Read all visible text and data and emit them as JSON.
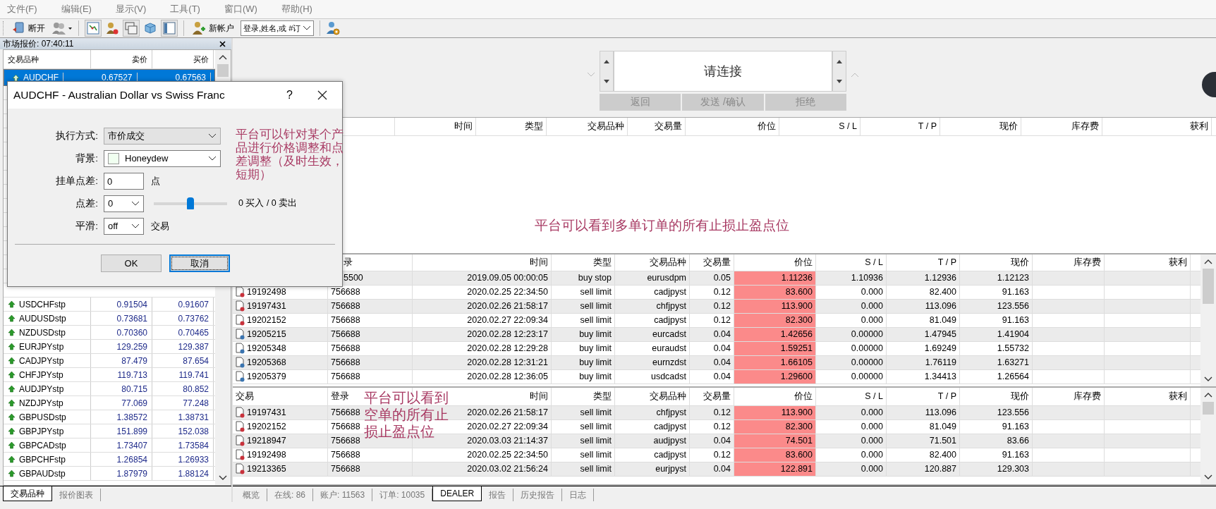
{
  "menu": [
    {
      "label": "文件(F)"
    },
    {
      "label": "编辑(E)"
    },
    {
      "label": "显示(V)"
    },
    {
      "label": "工具(T)"
    },
    {
      "label": "窗口(W)"
    },
    {
      "label": "帮助(H)"
    }
  ],
  "toolbar": {
    "disconnect": "断开",
    "new_account": "新帐户",
    "search": {
      "value": "登录,姓名,或 #订"
    }
  },
  "market_watch": {
    "title": "市场报价: 07:40:11",
    "columns": [
      "交易品种",
      "卖价",
      "买价"
    ],
    "top_rows": [
      {
        "symbol": "AUDCHF",
        "bid": "0.67527",
        "ask": "0.67563",
        "selected": true
      }
    ],
    "lower_rows": [
      {
        "symbol": "USDCHFstp",
        "bid": "0.91504",
        "ask": "0.91607",
        "selected": false
      },
      {
        "symbol": "AUDUSDstp",
        "bid": "0.73681",
        "ask": "0.73762",
        "selected": false
      },
      {
        "symbol": "NZDUSDstp",
        "bid": "0.70360",
        "ask": "0.70465",
        "selected": false
      },
      {
        "symbol": "EURJPYstp",
        "bid": "129.259",
        "ask": "129.387",
        "selected": false
      },
      {
        "symbol": "CADJPYstp",
        "bid": "87.479",
        "ask": "87.654",
        "selected": false
      },
      {
        "symbol": "CHFJPYstp",
        "bid": "119.713",
        "ask": "119.741",
        "selected": false
      },
      {
        "symbol": "AUDJPYstp",
        "bid": "80.715",
        "ask": "80.852",
        "selected": false
      },
      {
        "symbol": "NZDJPYstp",
        "bid": "77.069",
        "ask": "77.248",
        "selected": false
      },
      {
        "symbol": "GBPUSDstp",
        "bid": "1.38572",
        "ask": "1.38731",
        "selected": false
      },
      {
        "symbol": "GBPJPYstp",
        "bid": "151.899",
        "ask": "152.038",
        "selected": false
      },
      {
        "symbol": "GBPCADstp",
        "bid": "1.73407",
        "ask": "1.73584",
        "selected": false
      },
      {
        "symbol": "GBPCHFstp",
        "bid": "1.26854",
        "ask": "1.26933",
        "selected": false
      },
      {
        "symbol": "GBPAUDstp",
        "bid": "1.87979",
        "ask": "1.88124",
        "selected": false
      }
    ],
    "tabs": [
      {
        "label": "交易品种",
        "selected": true
      },
      {
        "label": "报价图表",
        "selected": false
      }
    ]
  },
  "dialog": {
    "title": "AUDCHF - Australian Dollar vs Swiss Franc",
    "help": "?",
    "fields": [
      {
        "kind": "combo",
        "label": "执行方式:",
        "value": "市价成交"
      },
      {
        "kind": "color",
        "label": "背景:",
        "value": "Honeydew",
        "color": "#f0fff0"
      },
      {
        "kind": "input",
        "label": "挂单点差:",
        "value": "0",
        "suffix": "点"
      },
      {
        "kind": "spread",
        "label": "点差:",
        "value": "0",
        "level": 0.5,
        "reading": "0 买入 / 0 卖出"
      },
      {
        "kind": "select",
        "label": "平滑:",
        "value": "off",
        "suffix": "交易"
      }
    ],
    "buttons": [
      {
        "label": "OK",
        "focused": false
      },
      {
        "label": "取消",
        "focused": true
      }
    ],
    "note": "平台可以针对某个产品进行价格调整和点差调整（及时生效，短期）"
  },
  "dealer": {
    "message": "请连接",
    "buttons": [
      "返回",
      "发送 /确认",
      "拒绝"
    ]
  },
  "order_tables": [
    {
      "columns": [
        "时间",
        "类型",
        "交易品种",
        "交易量",
        "价位",
        "S / L",
        "T / P",
        "现价",
        "库存费",
        "获利"
      ],
      "note": "平台可以看到多单订单的所有止损止盈点位"
    },
    {
      "columns": [
        "录",
        "时间",
        "类型",
        "交易品种",
        "交易量",
        "价位",
        "S / L",
        "T / P",
        "现价",
        "库存费",
        "获利"
      ],
      "rows": [
        {
          "cells": [
            "5500",
            "2019.09.05 00:00:05",
            "buy stop",
            "eurusdpm",
            "0.05",
            "1.11236",
            "1.10936",
            "1.12936",
            "1.12123"
          ]
        },
        {
          "kind": "sell",
          "cells": [
            "19192498",
            "756688",
            "2020.02.25 22:34:50",
            "sell limit",
            "cadjpyst",
            "0.12",
            "83.600",
            "0.000",
            "82.400",
            "91.163"
          ]
        },
        {
          "kind": "sell",
          "cells": [
            "19197431",
            "756688",
            "2020.02.26 21:58:17",
            "sell limit",
            "chfjpyst",
            "0.12",
            "113.900",
            "0.000",
            "113.096",
            "123.556"
          ]
        },
        {
          "kind": "sell",
          "cells": [
            "19202152",
            "756688",
            "2020.02.27 22:09:34",
            "sell limit",
            "cadjpyst",
            "0.12",
            "82.300",
            "0.000",
            "81.049",
            "91.163"
          ]
        },
        {
          "kind": "buy",
          "cells": [
            "19205215",
            "756688",
            "2020.02.28 12:23:17",
            "buy limit",
            "eurcadst",
            "0.04",
            "1.42656",
            "0.00000",
            "1.47945",
            "1.41904"
          ]
        },
        {
          "kind": "buy",
          "cells": [
            "19205348",
            "756688",
            "2020.02.28 12:29:28",
            "buy limit",
            "euraudst",
            "0.04",
            "1.59251",
            "0.00000",
            "1.69249",
            "1.55732"
          ]
        },
        {
          "kind": "buy",
          "cells": [
            "19205368",
            "756688",
            "2020.02.28 12:31:21",
            "buy limit",
            "eurnzdst",
            "0.04",
            "1.66105",
            "0.00000",
            "1.76119",
            "1.63271"
          ]
        },
        {
          "kind": "buy",
          "cells": [
            "19205379",
            "756688",
            "2020.02.28 12:36:05",
            "buy limit",
            "usdcadst",
            "0.04",
            "1.29600",
            "0.00000",
            "1.34413",
            "1.26564"
          ]
        }
      ]
    },
    {
      "columns": [
        "交易",
        "登录",
        "时间",
        "类型",
        "交易品种",
        "交易量",
        "价位",
        "S / L",
        "T / P",
        "现价",
        "库存费",
        "获利"
      ],
      "note": "平台可以看到空单的所有止损止盈点位",
      "rows": [
        {
          "kind": "sell",
          "cells": [
            "19197431",
            "756688",
            "2020.02.26 21:58:17",
            "sell limit",
            "chfjpyst",
            "0.12",
            "113.900",
            "0.000",
            "113.096",
            "123.556"
          ]
        },
        {
          "kind": "sell",
          "cells": [
            "19202152",
            "756688",
            "2020.02.27 22:09:34",
            "sell limit",
            "cadjpyst",
            "0.12",
            "82.300",
            "0.000",
            "81.049",
            "91.163"
          ]
        },
        {
          "kind": "sell",
          "cells": [
            "19218947",
            "756688",
            "2020.03.03 21:14:37",
            "sell limit",
            "audjpyst",
            "0.04",
            "74.501",
            "0.000",
            "71.501",
            "83.66"
          ]
        },
        {
          "kind": "sell",
          "cells": [
            "19192498",
            "756688",
            "2020.02.25 22:34:50",
            "sell limit",
            "cadjpyst",
            "0.12",
            "83.600",
            "0.000",
            "82.400",
            "91.163"
          ]
        },
        {
          "kind": "sell",
          "cells": [
            "19213365",
            "756688",
            "2020.03.02 21:56:24",
            "sell limit",
            "eurjpyst",
            "0.04",
            "122.891",
            "0.000",
            "120.887",
            "129.303"
          ]
        }
      ]
    }
  ],
  "bottom_tabs": [
    {
      "label": "概览",
      "selected": false
    },
    {
      "label": "在线: 86",
      "selected": false
    },
    {
      "label": "账户: 11563",
      "selected": false
    },
    {
      "label": "订单: 10035",
      "selected": false
    },
    {
      "label": "DEALER",
      "selected": true
    },
    {
      "label": "报告",
      "selected": false
    },
    {
      "label": "历史报告",
      "selected": false
    },
    {
      "label": "日志",
      "selected": false
    }
  ]
}
